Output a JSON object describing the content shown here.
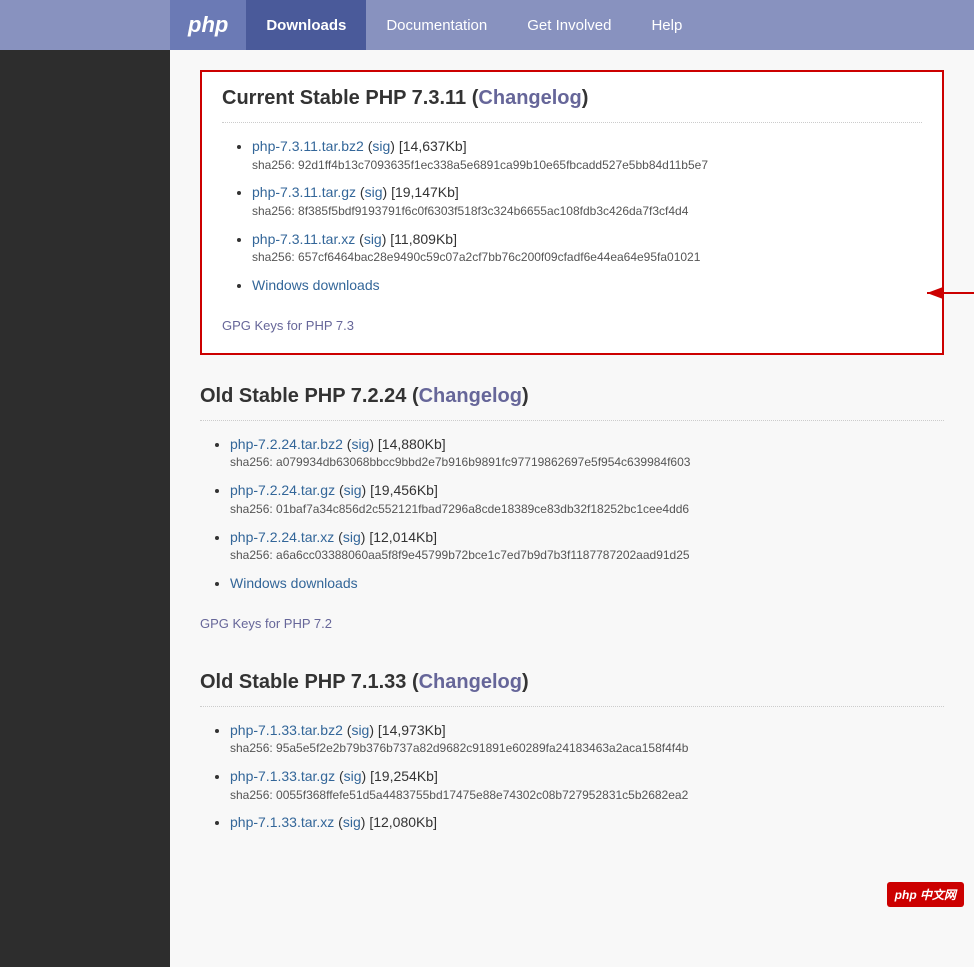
{
  "nav": {
    "logo": "php",
    "items": [
      {
        "label": "Downloads",
        "active": true
      },
      {
        "label": "Documentation",
        "active": false
      },
      {
        "label": "Get Involved",
        "active": false
      },
      {
        "label": "Help",
        "active": false
      }
    ]
  },
  "sections": [
    {
      "id": "current",
      "title": "Current Stable PHP 7.3.11",
      "changelog_label": "Changelog",
      "is_current": true,
      "files": [
        {
          "name": "php-7.3.11.tar.bz2",
          "sig_label": "sig",
          "size": "[14,637Kb]",
          "sha": "sha256: 92d1ff4b13c7093635f1ec338a5e6891ca99b10e65fbcadd527e5bb84d11b5e7"
        },
        {
          "name": "php-7.3.11.tar.gz",
          "sig_label": "sig",
          "size": "[19,147Kb]",
          "sha": "sha256: 8f385f5bdf9193791f6c0f6303f518f3c324b6655ac108fdb3c426da7f3cf4d4"
        },
        {
          "name": "php-7.3.11.tar.xz",
          "sig_label": "sig",
          "size": "[11,809Kb]",
          "sha": "sha256: 657cf6464bac28e9490c59c07a2cf7bb76c200f09cfadf6e44ea64e95fa01021"
        },
        {
          "name": "Windows downloads",
          "sig_label": "",
          "size": "",
          "sha": "",
          "is_windows": true,
          "has_arrow": true
        }
      ],
      "gpg_label": "GPG Keys for PHP 7.3"
    },
    {
      "id": "old72",
      "title": "Old Stable PHP 7.2.24",
      "changelog_label": "Changelog",
      "is_current": false,
      "files": [
        {
          "name": "php-7.2.24.tar.bz2",
          "sig_label": "sig",
          "size": "[14,880Kb]",
          "sha": "sha256: a079934db63068bbcc9bbd2e7b916b9891fc97719862697e5f954c639984f603"
        },
        {
          "name": "php-7.2.24.tar.gz",
          "sig_label": "sig",
          "size": "[19,456Kb]",
          "sha": "sha256: 01baf7a34c856d2c552121fbad7296a8cde18389ce83db32f18252bc1cee4dd6"
        },
        {
          "name": "php-7.2.24.tar.xz",
          "sig_label": "sig",
          "size": "[12,014Kb]",
          "sha": "sha256: a6a6cc03388060aa5f8f9e45799b72bce1c7ed7b9d7b3f1187787202aad91d25"
        },
        {
          "name": "Windows downloads",
          "sig_label": "",
          "size": "",
          "sha": "",
          "is_windows": true,
          "has_arrow": false
        }
      ],
      "gpg_label": "GPG Keys for PHP 7.2"
    },
    {
      "id": "old71",
      "title": "Old Stable PHP 7.1.33",
      "changelog_label": "Changelog",
      "is_current": false,
      "files": [
        {
          "name": "php-7.1.33.tar.bz2",
          "sig_label": "sig",
          "size": "[14,973Kb]",
          "sha": "sha256: 95a5e5f2e2b79b376b737a82d9682c91891e60289fa24183463a2aca158f4f4b"
        },
        {
          "name": "php-7.1.33.tar.gz",
          "sig_label": "sig",
          "size": "[19,254Kb]",
          "sha": "sha256: 0055f368ffefe51d5a4483755bd17475e88e74302c08b727952831c5b2682ea2"
        },
        {
          "name": "php-7.1.33.tar.xz",
          "sig_label": "sig",
          "size": "[12,080Kb]",
          "sha": "",
          "partial": true
        }
      ],
      "gpg_label": ""
    }
  ],
  "badge": {
    "label": "php 中文网"
  }
}
